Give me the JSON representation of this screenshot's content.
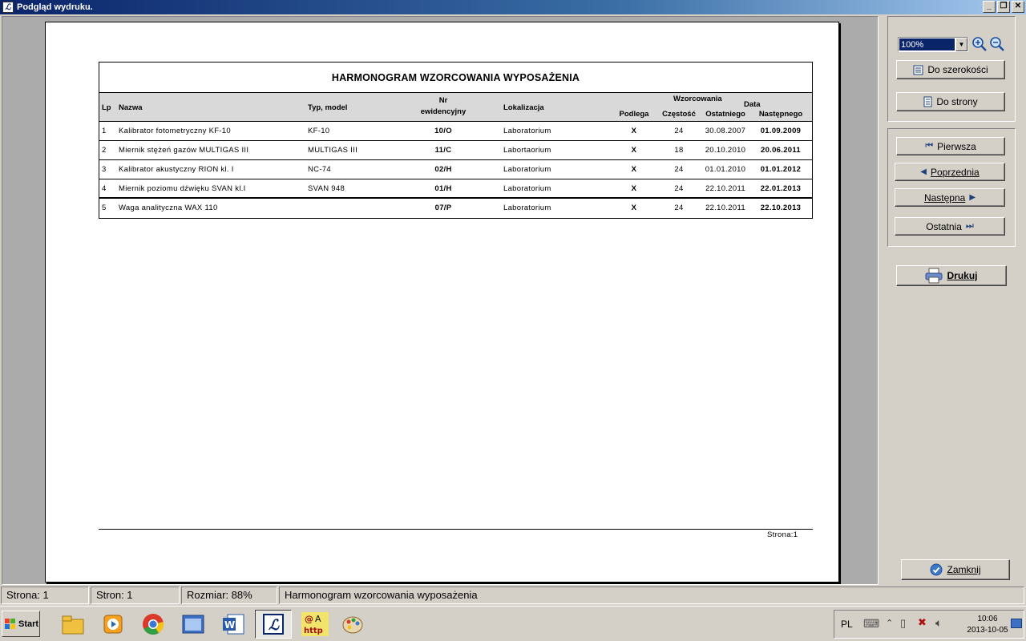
{
  "window": {
    "title": "Podgląd wydruku."
  },
  "report": {
    "title": "HARMONOGRAM WZORCOWANIA WYPOSAŻENIA",
    "headers": {
      "lp": "Lp",
      "nazwa": "Nazwa",
      "typ": "Typ, model",
      "nr_line1": "Nr",
      "nr_line2": "ewidencyjny",
      "lokalizacja": "Lokalizacja",
      "wzorcowania": "Wzorcowania",
      "data": "Data",
      "podlega": "Podlega",
      "czestosc": "Częstość",
      "ostatniego": "Ostatniego",
      "nastepnego": "Następnego"
    },
    "rows": [
      {
        "lp": "1",
        "nazwa": "Kalibrator fotometryczny KF-10",
        "typ": "KF-10",
        "nr": "10/O",
        "lokalizacja": "Laboratorium",
        "podlega": "X",
        "czestosc": "24",
        "ostatniego": "30.08.2007",
        "nastepnego": "01.09.2009"
      },
      {
        "lp": "2",
        "nazwa": "Miernik stężeń gazów MULTIGAS III",
        "typ": "MULTIGAS III",
        "nr": "11/C",
        "lokalizacja": "Labortaorium",
        "podlega": "X",
        "czestosc": "18",
        "ostatniego": "20.10.2010",
        "nastepnego": "20.06.2011"
      },
      {
        "lp": "3",
        "nazwa": "Kalibrator akustyczny RION kl. I",
        "typ": "NC-74",
        "nr": "02/H",
        "lokalizacja": "Laboratorium",
        "podlega": "X",
        "czestosc": "24",
        "ostatniego": "01.01.2010",
        "nastepnego": "01.01.2012"
      },
      {
        "lp": "4",
        "nazwa": "Miernik poziomu dźwięku SVAN kl.I",
        "typ": "SVAN 948",
        "nr": "01/H",
        "lokalizacja": "Laboratorium",
        "podlega": "X",
        "czestosc": "24",
        "ostatniego": "22.10.2011",
        "nastepnego": "22.01.2013"
      },
      {
        "lp": "5",
        "nazwa": "Waga analityczna WAX 110",
        "typ": "",
        "nr": "07/P",
        "lokalizacja": "Laboratorium",
        "podlega": "X",
        "czestosc": "24",
        "ostatniego": "22.10.2011",
        "nastepnego": "22.10.2013"
      }
    ],
    "page_label": "Strona:1"
  },
  "toolbar": {
    "zoom": "100%",
    "fit_width": "Do szerokości",
    "fit_page": "Do strony",
    "first": "Pierwsza",
    "prev": "Poprzednia",
    "next": "Następna",
    "last": "Ostatnia",
    "print": "Drukuj",
    "close": "Zamknij"
  },
  "status": {
    "page": "Strona: 1",
    "pages": "Stron: 1",
    "size": "Rozmiar: 88%",
    "doc": "Harmonogram wzorcowania wyposażenia"
  },
  "taskbar": {
    "start": "Start",
    "lang": "PL",
    "time": "10:06",
    "date": "2013-10-05"
  },
  "colors": {
    "title_bar": "#0a246a",
    "header_bg": "#d9d9d9",
    "face": "#d4d0c8"
  }
}
